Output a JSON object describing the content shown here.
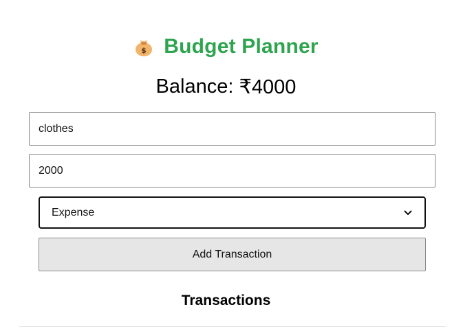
{
  "header": {
    "icon": "money-bag-icon",
    "title": "Budget Planner",
    "title_color": "#2ea44f"
  },
  "balance": {
    "label": "Balance: ",
    "value": "₹4000"
  },
  "form": {
    "description_value": "clothes",
    "amount_value": "2000",
    "type_selected": "Expense",
    "submit_label": "Add Transaction"
  },
  "transactions": {
    "heading": "Transactions"
  }
}
